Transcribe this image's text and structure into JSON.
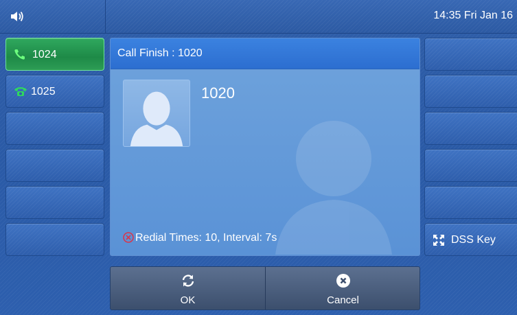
{
  "status_bar": {
    "volume_icon": "speaker-icon",
    "datetime": "14:35 Fri Jan 16"
  },
  "line_keys": [
    {
      "label": "1024",
      "icon": "phone-handset-icon",
      "active": true
    },
    {
      "label": "1025",
      "icon": "old-phone-icon",
      "active": false
    },
    {
      "label": "",
      "active": false
    },
    {
      "label": "",
      "active": false
    },
    {
      "label": "",
      "active": false
    },
    {
      "label": "",
      "active": false
    }
  ],
  "right_keys": [
    {
      "label": ""
    },
    {
      "label": ""
    },
    {
      "label": ""
    },
    {
      "label": ""
    },
    {
      "label": ""
    },
    {
      "label": "DSS Key",
      "icon": "expand-arrows-icon"
    }
  ],
  "call_panel": {
    "title": "Call Finish : 1020",
    "contact_name": "1020",
    "avatar_icon": "contact-silhouette-icon",
    "status_text": "Redial Times: 10, Interval: 7s",
    "status_icon": "error-x-icon"
  },
  "softkeys": [
    {
      "label": "OK",
      "icon": "refresh-icon"
    },
    {
      "label": "Cancel",
      "icon": "cancel-x-icon"
    }
  ],
  "colors": {
    "background": "#2c5aa6",
    "active_line": "#1e8a47",
    "panel": "#5a92d6",
    "error": "#d8364c"
  }
}
